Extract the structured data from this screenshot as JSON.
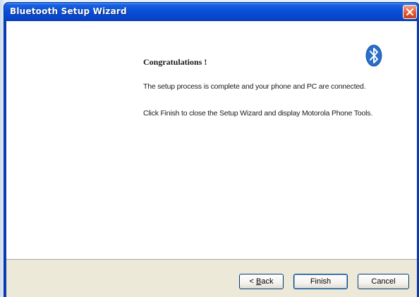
{
  "window": {
    "title": "Bluetooth Setup Wizard"
  },
  "icons": {
    "close": "close-icon",
    "logo": "bluetooth-icon"
  },
  "content": {
    "heading": "Congratulations !",
    "paragraph1": "The setup process is complete and your phone and PC are connected.",
    "paragraph2": "Click Finish to close the Setup Wizard and display Motorola Phone Tools."
  },
  "buttons": {
    "back_prefix": "< ",
    "back_accel": "B",
    "back_rest": "ack",
    "finish": "Finish",
    "cancel": "Cancel"
  },
  "colors": {
    "titlebar": "#0a4fd6",
    "close_button": "#e35b33",
    "bluetooth_blue": "#1f5fb4",
    "dialog_face": "#ece9d8"
  }
}
